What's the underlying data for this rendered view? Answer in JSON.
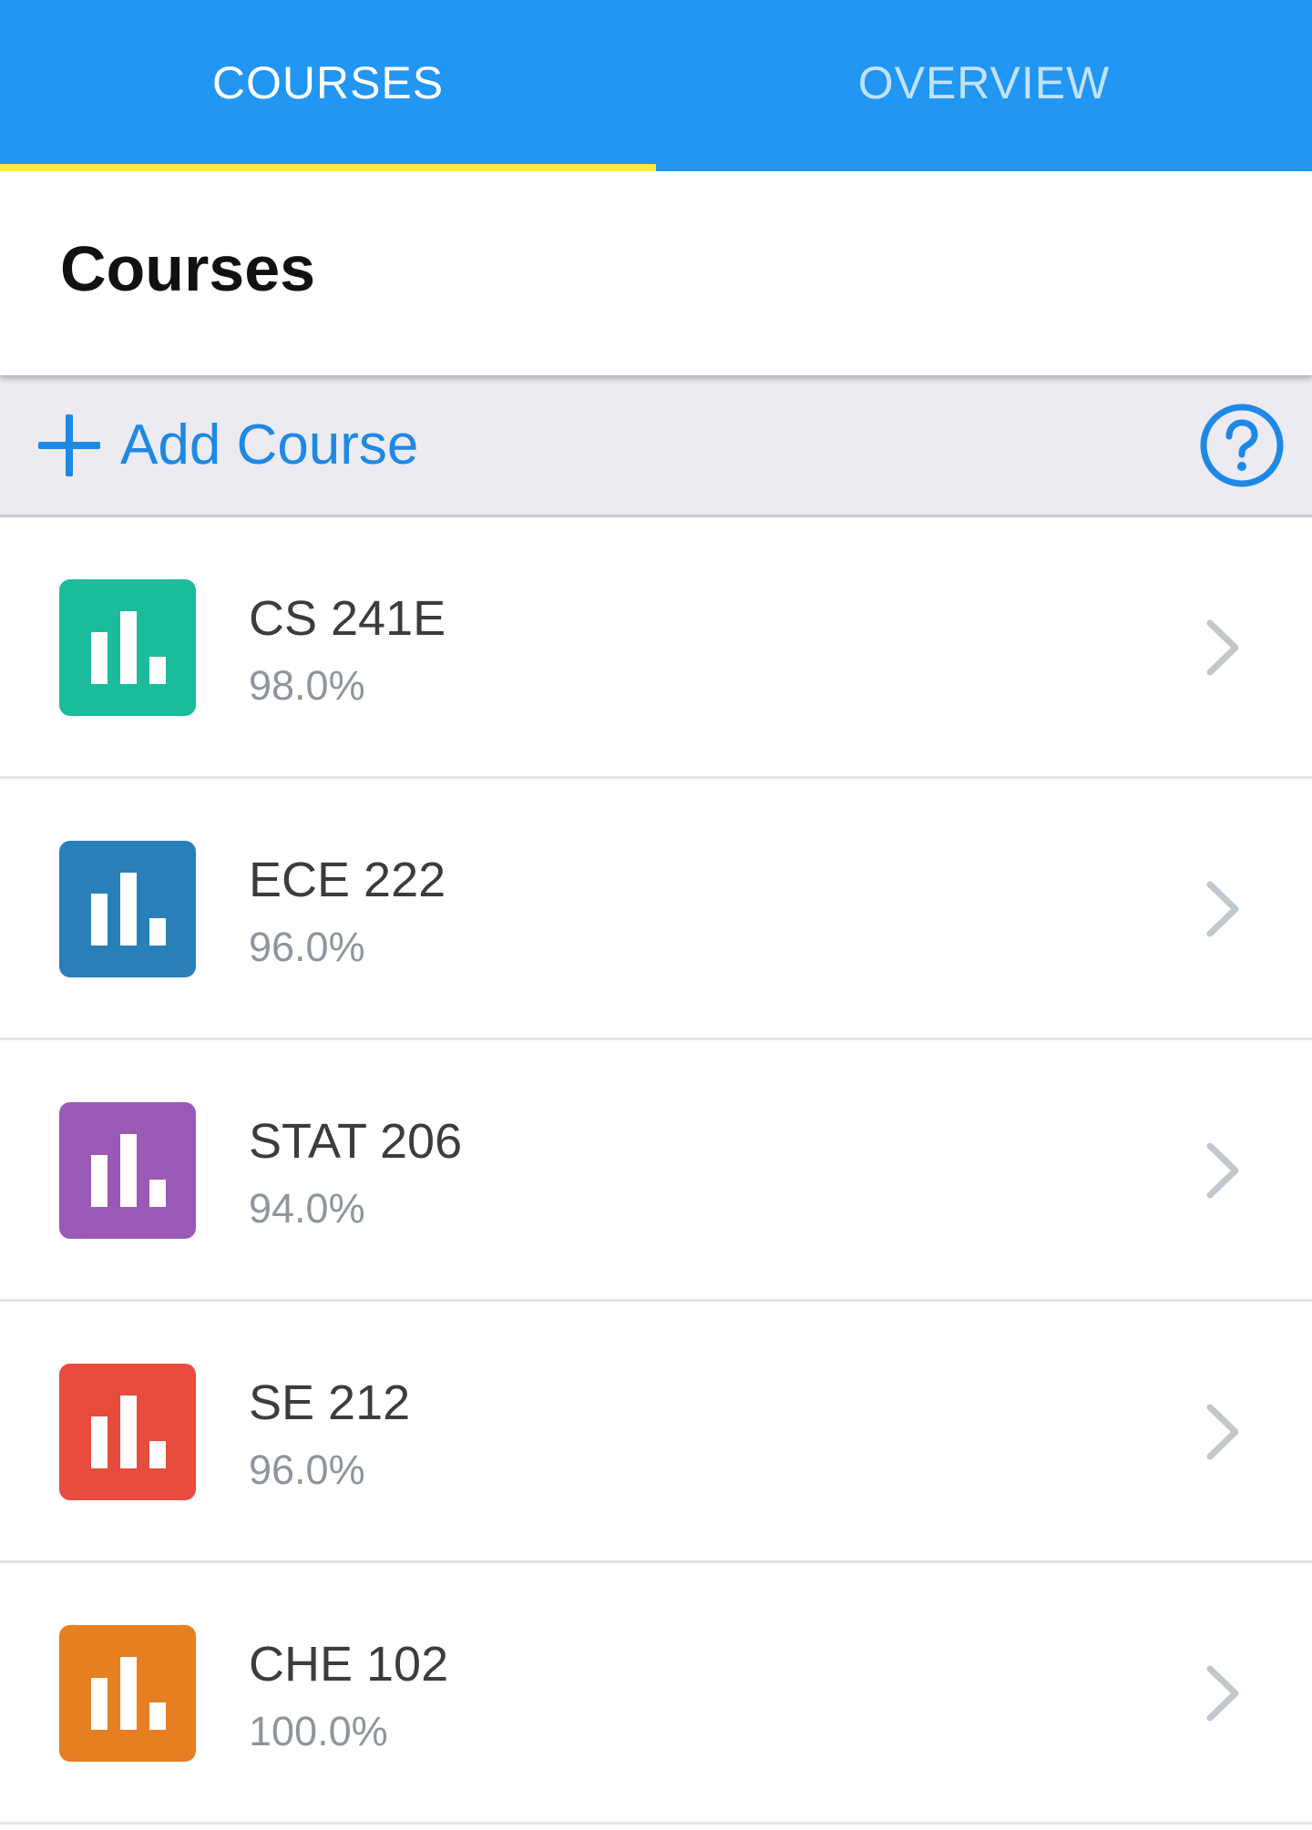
{
  "tabs": [
    {
      "label": "COURSES",
      "active": true
    },
    {
      "label": "OVERVIEW",
      "active": false
    }
  ],
  "header": {
    "title": "Courses"
  },
  "toolbar": {
    "add_label": "Add Course",
    "add_icon": "plus-icon",
    "help_icon": "help-circle-icon"
  },
  "colors": {
    "tab_bar": "#2196F3",
    "tab_indicator": "#FFEB3B",
    "accent": "#1E88E5",
    "toolbar_bg": "#EBEBF1"
  },
  "courses": [
    {
      "name": "CS 241E",
      "grade": "98.0%",
      "color": "#1ABC9C"
    },
    {
      "name": "ECE 222",
      "grade": "96.0%",
      "color": "#2980B9"
    },
    {
      "name": "STAT 206",
      "grade": "94.0%",
      "color": "#9B59B6"
    },
    {
      "name": "SE 212",
      "grade": "96.0%",
      "color": "#E74C3C"
    },
    {
      "name": "CHE 102",
      "grade": "100.0%",
      "color": "#E67E22"
    }
  ]
}
